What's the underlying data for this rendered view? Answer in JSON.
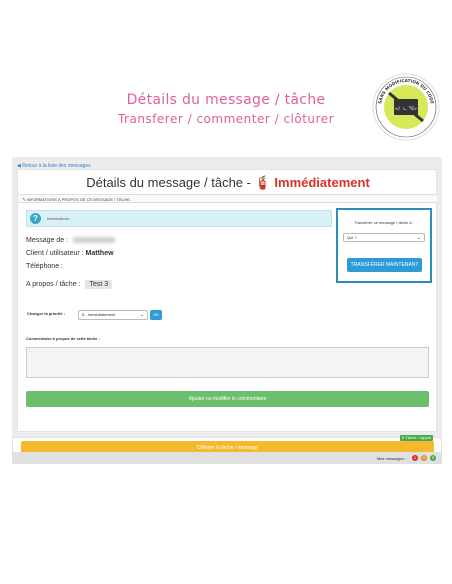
{
  "header": {
    "title": "Détails du message / tâche",
    "subtitle": "Transferer / commenter / clôturer"
  },
  "badge": {
    "text_top": "SANS MODIFICATION DU CODE",
    "code": "</ CODE>"
  },
  "app": {
    "back_link": "◀ Retour à la liste des messages",
    "page_title": "Détails du message / tâche -",
    "priority_urgent": "Immédiatement",
    "section_title": "INFORMATIONS À PROPOS DE CE MESSAGE / TÂCHE.",
    "info_label": "Informations :",
    "info_icon": "?",
    "fields": {
      "message_label": "Message de :",
      "client_label": "Client / utilisateur :",
      "client_value": "Matthew",
      "phone_label": "Téléphone :",
      "about_label": "A propos / tâche :",
      "about_value": "Test 3"
    },
    "priority_change_label": "Changer la priorité :",
    "priority_select_value": "5 - Immédiatement",
    "ok_label": "OK",
    "comment_label": "Commentaire à propos de cette tâche :",
    "comment_value": "",
    "add_comment_label": "Ajouter ou modifier le commentaire",
    "transfer": {
      "label": "Transférer ce message / tâche à :",
      "select_value": "Qui ?",
      "button_label": "TRANSFÉRER MAINTENANT"
    },
    "close_button_label": "Clôturer la tâche / message",
    "small_tag": "6 Tâche / rappel",
    "footer_label": "Mes messages :",
    "footer_counts": [
      "1",
      "0",
      "0"
    ]
  },
  "colors": {
    "accent_pink": "#e0609a",
    "primary_blue": "#2e9bd6",
    "success_green": "#6bbf6e",
    "warning_yellow": "#f3ba2e",
    "urgent_red": "#d6322a"
  }
}
